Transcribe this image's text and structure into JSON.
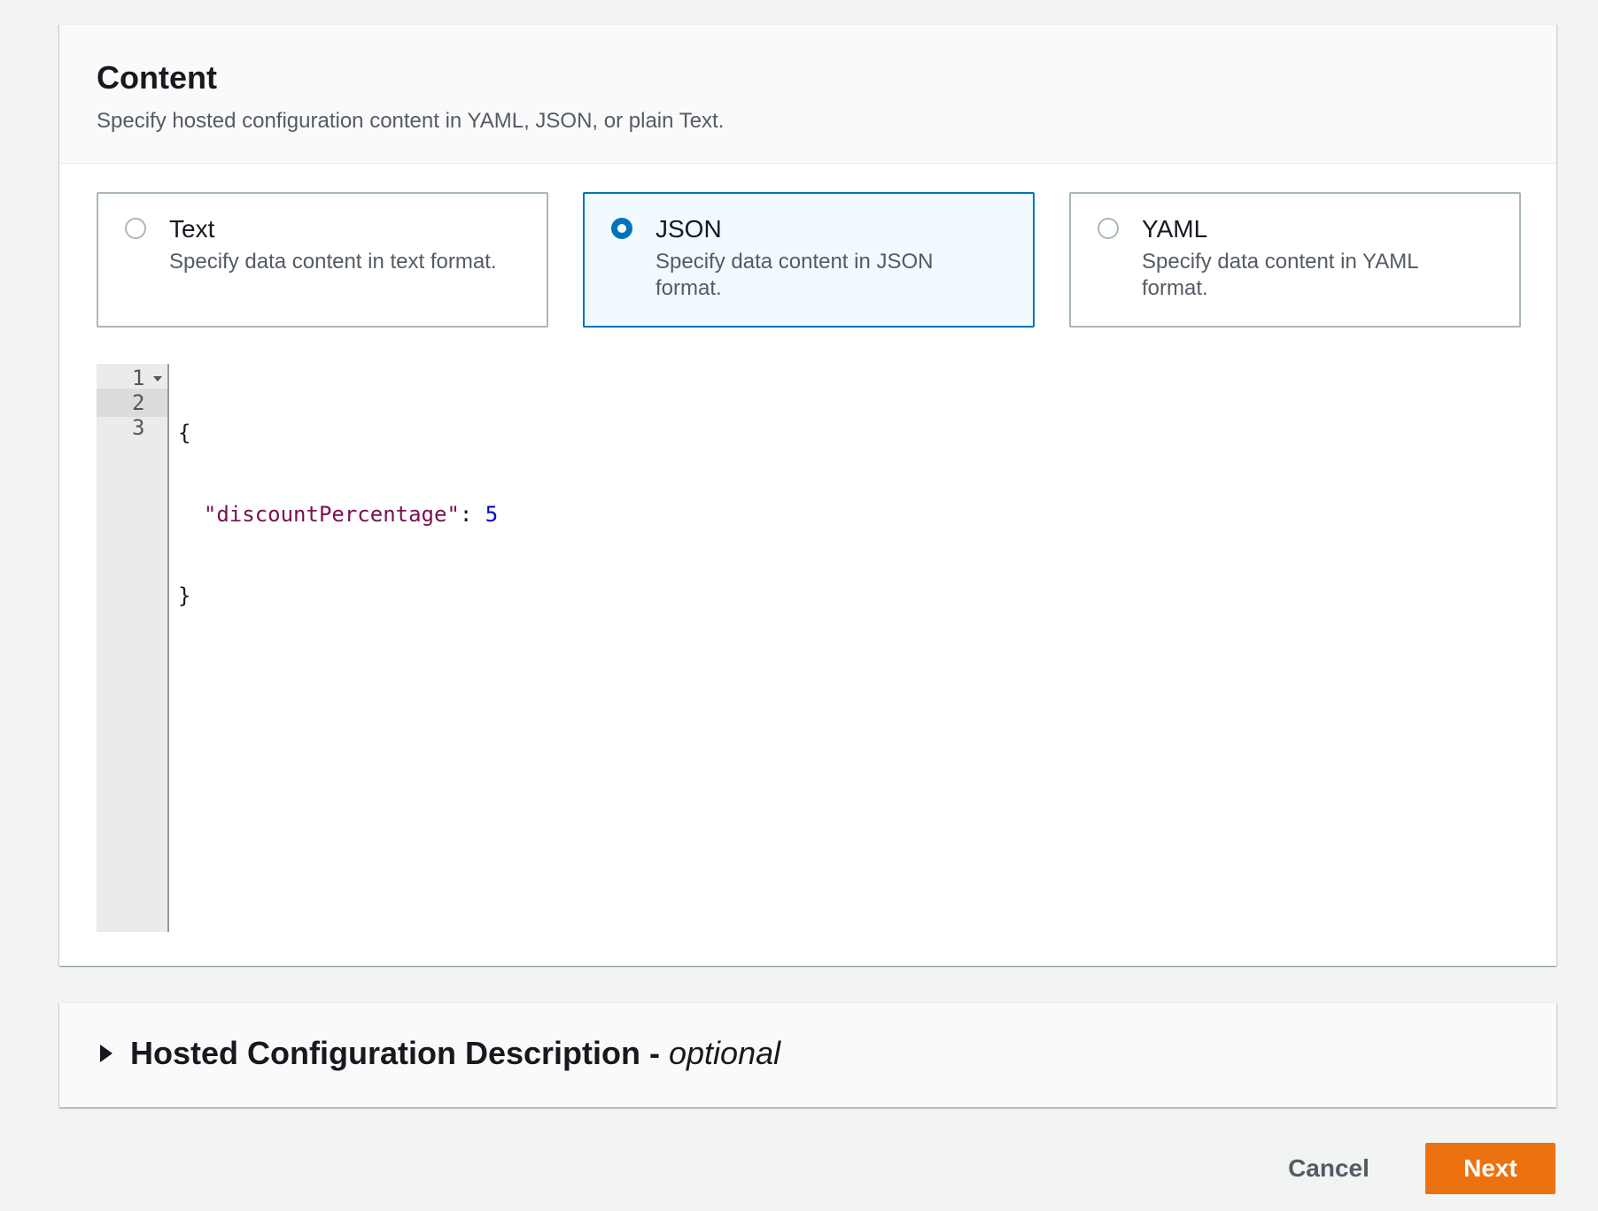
{
  "content_panel": {
    "title": "Content",
    "subtitle": "Specify hosted configuration content in YAML, JSON, or plain Text."
  },
  "format_options": [
    {
      "label": "Text",
      "description": "Specify data content in text format.",
      "selected": false
    },
    {
      "label": "JSON",
      "description": "Specify data content in JSON format.",
      "selected": true
    },
    {
      "label": "YAML",
      "description": "Specify data content in YAML format.",
      "selected": false
    }
  ],
  "editor": {
    "line_numbers": [
      "1",
      "2",
      "3"
    ],
    "active_line": 2,
    "lines": {
      "l1": "{",
      "l2_indent": "  ",
      "l2_key": "\"discountPercentage\"",
      "l2_sep": ": ",
      "l2_value": "5",
      "l3": "}"
    }
  },
  "description_section": {
    "title": "Hosted Configuration Description -",
    "optional": "optional",
    "expanded": false
  },
  "actions": {
    "cancel_label": "Cancel",
    "next_label": "Next"
  },
  "colors": {
    "accent": "#0073bb",
    "primary_button": "#ec7211",
    "json_key": "#7a0f52",
    "json_number": "#0000cd"
  }
}
